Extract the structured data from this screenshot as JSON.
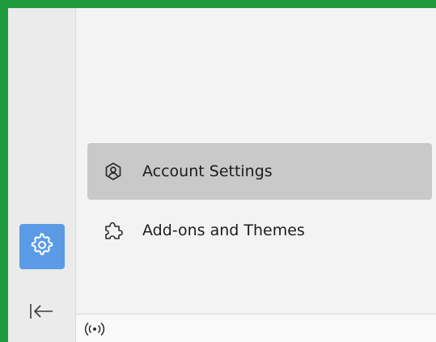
{
  "sidebar": {
    "settings_icon": "gear-icon",
    "collapse_icon": "collapse-arrow-icon",
    "accent_color": "#5b9be6"
  },
  "menu": {
    "items": [
      {
        "label": "Account Settings",
        "icon": "account-icon",
        "selected": true
      },
      {
        "label": "Add-ons and Themes",
        "icon": "puzzle-icon",
        "selected": false
      }
    ]
  },
  "status_bar": {
    "activity_icon": "online-status-icon"
  },
  "colors": {
    "frame": "#1f9a3c",
    "selected_item": "#c9c9c9"
  }
}
